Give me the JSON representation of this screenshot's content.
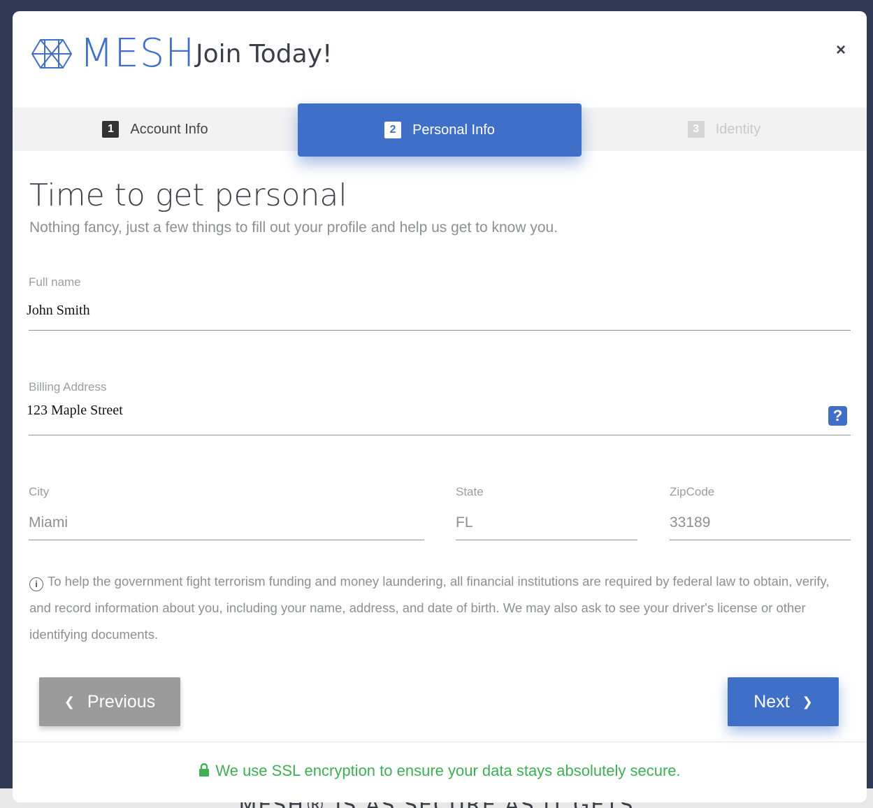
{
  "background": {
    "partial_text": "MESH® IS AS SECURE AS IT GETS"
  },
  "header": {
    "brand": "MESH",
    "title": "Join Today!",
    "close_label": "×"
  },
  "steps": [
    {
      "number": "1",
      "label": "Account Info",
      "state": "complete"
    },
    {
      "number": "2",
      "label": "Personal Info",
      "state": "active"
    },
    {
      "number": "3",
      "label": "Identity",
      "state": "disabled"
    }
  ],
  "main": {
    "title": "Time to get personal",
    "subtitle": "Nothing fancy, just a few things to fill out your profile and help us get to know you."
  },
  "form": {
    "full_name": {
      "label": "Full name",
      "value": "John Smith"
    },
    "billing_address": {
      "label": "Billing Address",
      "value": "123 Maple Street",
      "help": "?"
    },
    "city": {
      "label": "City",
      "value": "Miami"
    },
    "state": {
      "label": "State",
      "value": "FL"
    },
    "zipcode": {
      "label": "ZipCode",
      "value": "33189"
    }
  },
  "notice": {
    "icon": "info-icon",
    "text": "To help the government fight terrorism funding and money laundering, all financial institutions are required by federal law to obtain, verify, and record information about you, including your name, address, and date of birth. We may also ask to see your driver's license or other identifying documents."
  },
  "buttons": {
    "previous": "Previous",
    "next": "Next"
  },
  "footer": {
    "ssl_text": "We use SSL encryption to ensure your data stays absolutely secure."
  },
  "colors": {
    "accent": "#3f6fc6",
    "success": "#3fae55",
    "secondary_button": "#9b9b9b"
  }
}
